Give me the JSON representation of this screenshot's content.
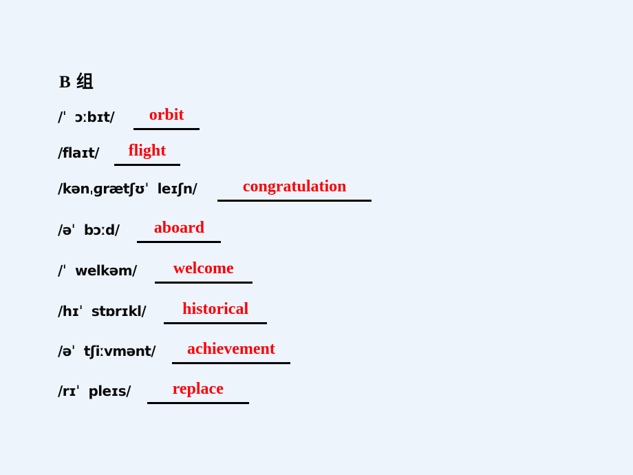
{
  "slide": {
    "heading": "B 组",
    "background_color": "#eef4fc",
    "answer_color": "#fb0006",
    "ipa_color": "#0a0a0a",
    "rule_color": "#000000",
    "entries": [
      {
        "ipa": "/ˈ  ɔːbɪt/",
        "answer": "orbit"
      },
      {
        "ipa": "/flaɪt/",
        "answer": "flight"
      },
      {
        "ipa": "/kənˌɡrætʃʊˈ  leɪʃn/",
        "answer": "congratulation"
      },
      {
        "ipa": "/əˈ  bɔːd/",
        "answer": "aboard"
      },
      {
        "ipa": "/ˈ  welkəm/",
        "answer": "welcome"
      },
      {
        "ipa": "/hɪˈ  stɒrɪkl/",
        "answer": "historical"
      },
      {
        "ipa": "/əˈ  tʃiːvmənt/",
        "answer": "achievement"
      },
      {
        "ipa": "/rɪˈ  pleɪs/",
        "answer": "replace"
      }
    ]
  }
}
